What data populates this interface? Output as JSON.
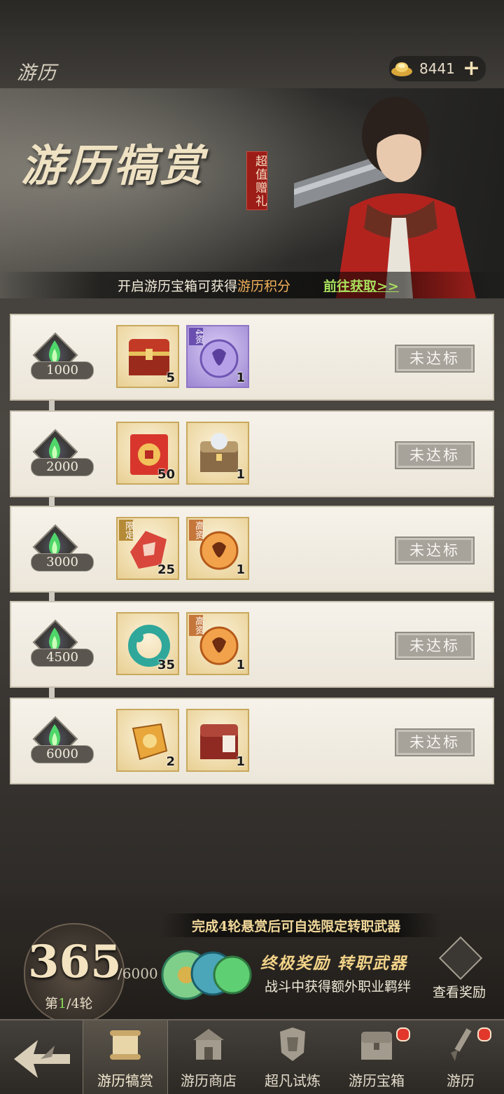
{
  "header": {
    "title": "游历",
    "currency": {
      "value": "8441",
      "plus_label": "+"
    }
  },
  "banner": {
    "title": "游历犒赏",
    "seal": "超值赠礼",
    "info_prefix": "开启游历宝箱可获得",
    "info_highlight": "游历积分",
    "link": "前往获取>>"
  },
  "rewards": [
    {
      "score": "1000",
      "status": "未达标",
      "items": [
        {
          "icon": "golden-chest-icon",
          "qty": "5"
        },
        {
          "icon": "purple-token-icon",
          "qty": "1",
          "tag": "4资"
        }
      ]
    },
    {
      "score": "2000",
      "status": "未达标",
      "items": [
        {
          "icon": "red-envelope-icon",
          "qty": "50"
        },
        {
          "icon": "silver-chest-icon",
          "qty": "1"
        }
      ]
    },
    {
      "score": "3000",
      "status": "未达标",
      "items": [
        {
          "icon": "red-fragment-icon",
          "qty": "25",
          "tag": "限定"
        },
        {
          "icon": "orange-token-icon",
          "qty": "1",
          "tag": "高资"
        }
      ]
    },
    {
      "score": "4500",
      "status": "未达标",
      "items": [
        {
          "icon": "jade-ring-icon",
          "qty": "35"
        },
        {
          "icon": "orange-token-icon",
          "qty": "1",
          "tag": "高资"
        }
      ]
    },
    {
      "score": "6000",
      "status": "未达标",
      "items": [
        {
          "icon": "gold-coin-icon",
          "qty": "2"
        },
        {
          "icon": "limited-chest-icon",
          "qty": "1"
        }
      ]
    }
  ],
  "progress": {
    "current": "365",
    "max": "/6000",
    "round_prefix": "第",
    "round_current": "1",
    "round_suffix": "/4轮"
  },
  "final_reward": {
    "notice": "完成4轮悬赏后可自选限定转职武器",
    "title": "终极奖励 转职武器",
    "subtitle": "战斗中获得额外职业羁绊",
    "view_label": "查看奖励"
  },
  "tabs": [
    {
      "label": "游历犒赏",
      "active": true,
      "icon": "scroll-icon"
    },
    {
      "label": "游历商店",
      "active": false,
      "icon": "shop-icon"
    },
    {
      "label": "超凡试炼",
      "active": false,
      "icon": "armor-icon"
    },
    {
      "label": "游历宝箱",
      "active": false,
      "icon": "chest-icon",
      "badge": true
    },
    {
      "label": "游历",
      "active": false,
      "icon": "brush-icon",
      "badge": true
    }
  ],
  "colors": {
    "accent_gold": "#f2b15a",
    "link_green": "#a9e05d",
    "badge_red": "#e2382c"
  }
}
